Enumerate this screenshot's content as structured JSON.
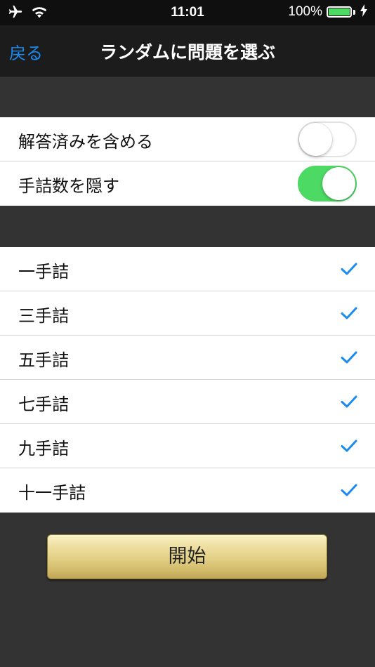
{
  "status_bar": {
    "time": "11:01",
    "battery_percent": "100%",
    "battery_level": 1.0,
    "icons": [
      "airplane-icon",
      "wifi-icon",
      "battery-icon",
      "charging-bolt-icon"
    ]
  },
  "nav": {
    "back_label": "戻る",
    "title": "ランダムに問題を選ぶ"
  },
  "options": [
    {
      "label": "解答済みを含める",
      "enabled": false
    },
    {
      "label": "手詰数を隠す",
      "enabled": true
    }
  ],
  "move_counts": [
    {
      "label": "一手詰",
      "checked": true
    },
    {
      "label": "三手詰",
      "checked": true
    },
    {
      "label": "五手詰",
      "checked": true
    },
    {
      "label": "七手詰",
      "checked": true
    },
    {
      "label": "九手詰",
      "checked": true
    },
    {
      "label": "十一手詰",
      "checked": true
    }
  ],
  "start_label": "開始",
  "colors": {
    "accent_blue": "#1a8bf0",
    "toggle_on": "#4cd964",
    "background": "#333333",
    "nav_background": "#1c1c1c"
  }
}
